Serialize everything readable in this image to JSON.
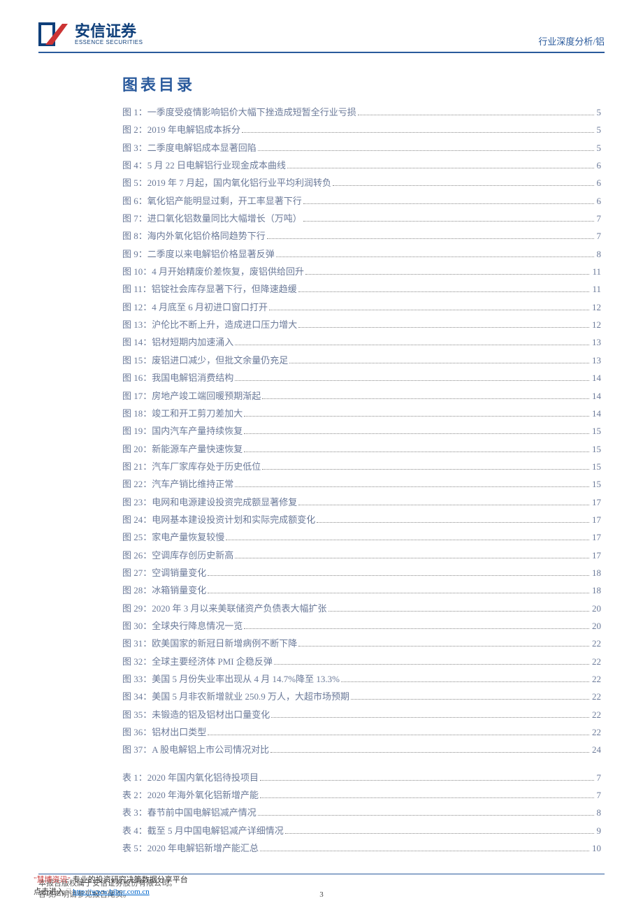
{
  "header": {
    "logo_cn": "安信证券",
    "logo_en": "ESSENCE SECURITIES",
    "right": "行业深度分析/铝"
  },
  "toc": {
    "title": "图表目录",
    "figures": [
      {
        "label": "图 1：一季度受疫情影响铝价大幅下挫造成短暂全行业亏损",
        "page": "5"
      },
      {
        "label": "图 2：2019 年电解铝成本拆分",
        "page": "5"
      },
      {
        "label": "图 3：二季度电解铝成本显著回陷",
        "page": "5"
      },
      {
        "label": "图 4：5 月 22 日电解铝行业现金成本曲线",
        "page": "6"
      },
      {
        "label": "图 5：2019 年 7 月起，国内氧化铝行业平均利润转负",
        "page": "6"
      },
      {
        "label": "图 6：氧化铝产能明显过剩，开工率显著下行",
        "page": "6"
      },
      {
        "label": "图 7：进口氧化铝数量同比大幅增长（万吨）",
        "page": "7"
      },
      {
        "label": "图 8：海内外氧化铝价格同趋势下行",
        "page": "7"
      },
      {
        "label": "图 9：二季度以来电解铝价格显著反弹",
        "page": "8"
      },
      {
        "label": "图 10：4 月开始精废价差恢复，废铝供给回升",
        "page": "11"
      },
      {
        "label": "图 11：铝锭社会库存显著下行，但降速趋缓",
        "page": "11"
      },
      {
        "label": "图 12：4 月底至 6 月初进口窗口打开",
        "page": "12"
      },
      {
        "label": "图 13：沪伦比不断上升，造成进口压力增大",
        "page": "12"
      },
      {
        "label": "图 14：铝材短期内加速涌入",
        "page": "13"
      },
      {
        "label": "图 15：废铝进口减少，但批文余量仍充足",
        "page": "13"
      },
      {
        "label": "图 16：我国电解铝消费结构",
        "page": "14"
      },
      {
        "label": "图 17：房地产竣工端回暖预期渐起",
        "page": "14"
      },
      {
        "label": "图 18：竣工和开工剪刀差加大",
        "page": "14"
      },
      {
        "label": "图 19：国内汽车产量持续恢复",
        "page": "15"
      },
      {
        "label": "图 20：新能源车产量快速恢复",
        "page": "15"
      },
      {
        "label": "图 21：汽车厂家库存处于历史低位",
        "page": "15"
      },
      {
        "label": "图 22：汽车产销比维持正常",
        "page": "15"
      },
      {
        "label": "图 23：电网和电源建设投资完成额显著修复",
        "page": "17"
      },
      {
        "label": "图 24：电网基本建设投资计划和实际完成额变化",
        "page": "17"
      },
      {
        "label": "图 25：家电产量恢复较慢",
        "page": "17"
      },
      {
        "label": "图 26：空调库存创历史新高",
        "page": "17"
      },
      {
        "label": "图 27：空调销量变化",
        "page": "18"
      },
      {
        "label": "图 28：冰箱销量变化",
        "page": "18"
      },
      {
        "label": "图 29：2020 年 3 月以来美联储资产负债表大幅扩张",
        "page": "20"
      },
      {
        "label": "图 30：全球央行降息情况一览",
        "page": "20"
      },
      {
        "label": "图 31：欧美国家的新冠日新增病例不断下降",
        "page": "22"
      },
      {
        "label": "图 32：全球主要经济体 PMI 企稳反弹",
        "page": "22"
      },
      {
        "label": "图 33：美国 5 月份失业率出现从 4 月 14.7%降至 13.3%",
        "page": "22"
      },
      {
        "label": "图 34：美国 5 月非农新增就业 250.9 万人，大超市场预期",
        "page": "22"
      },
      {
        "label": "图 35：未锻造的铝及铝材出口量变化",
        "page": "22"
      },
      {
        "label": "图 36：铝材出口类型",
        "page": "22"
      },
      {
        "label": "图 37：A 股电解铝上市公司情况对比",
        "page": "24"
      }
    ],
    "tables": [
      {
        "label": "表 1：2020 年国内氧化铝待投项目",
        "page": "7"
      },
      {
        "label": "表 2：2020 年海外氧化铝新增产能",
        "page": "7"
      },
      {
        "label": "表 3：春节前中国电解铝减产情况",
        "page": "8"
      },
      {
        "label": "表 4：截至 5 月中国电解铝减产详细情况",
        "page": "9"
      },
      {
        "label": "表 5：2020 年电解铝新增产能汇总",
        "page": "10"
      }
    ]
  },
  "footer": {
    "disclaimer1": "本报告版权属于安信证券股份有限公司。",
    "disclaimer2": "各项声明请参见报告尾页。",
    "overlay_brand": "\"慧博资讯\"",
    "overlay_tag": "专业的投资研究决策数据分享平台",
    "overlay_link_label": "点击进入",
    "overlay_link": "http://www.hibor.com.cn",
    "page_num": "3"
  }
}
